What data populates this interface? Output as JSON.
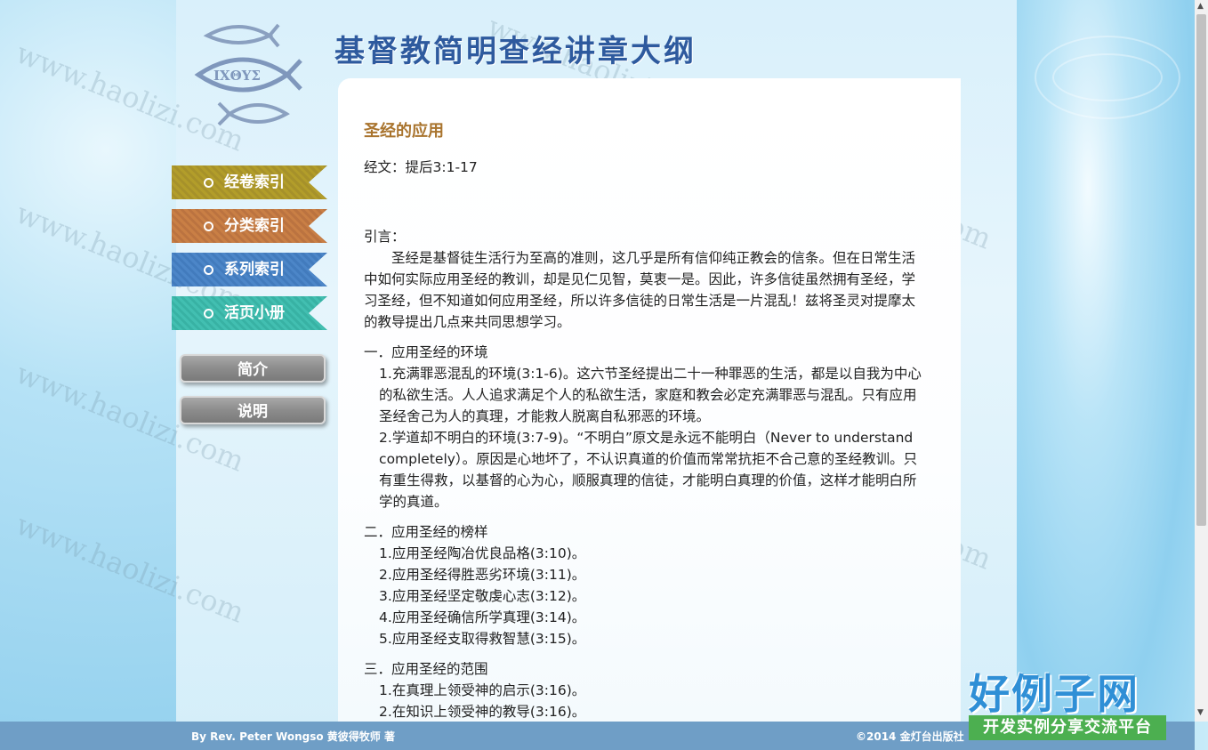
{
  "site": {
    "title": "基督教简明查经讲章大纲",
    "logo_text": "IXΘYΣ"
  },
  "nav": {
    "ribbons": [
      {
        "label": "经卷索引",
        "color": "#b29d2a"
      },
      {
        "label": "分类索引",
        "color": "#c97f45"
      },
      {
        "label": "系列索引",
        "color": "#4c86c8"
      },
      {
        "label": "活页小册",
        "color": "#42bfb1"
      }
    ],
    "buttons": [
      {
        "label": "简介"
      },
      {
        "label": "说明"
      }
    ]
  },
  "article": {
    "title": "圣经的应用",
    "scripture": "经文：提后3:1-17",
    "intro_label": "引言：",
    "intro_text": "圣经是基督徒生活行为至高的准则，这几乎是所有信仰纯正教会的信条。但在日常生活中如何实际应用圣经的教训，却是见仁见智，莫衷一是。因此，许多信徒虽然拥有圣经，学习圣经，但不知道如何应用圣经，所以许多信徒的日常生活是一片混乱！兹将圣灵对提摩太的教导提出几点来共同思想学习。",
    "sections": [
      {
        "heading": "一．应用圣经的环境",
        "items": [
          "1.充满罪恶混乱的环境(3:1-6)。这六节圣经提出二十一种罪恶的生活，都是以自我为中心的私欲生活。人人追求满足个人的私欲生活，家庭和教会必定充满罪恶与混乱。只有应用圣经舍己为人的真理，才能救人脱离自私邪恶的环境。",
          "2.学道却不明白的环境(3:7-9)。“不明白”原文是永远不能明白（Never to understand completely）。原因是心地坏了，不认识真道的价值而常常抗拒不合己意的圣经教训。只有重生得救，以基督的心为心，顺服真理的信徒，才能明白真理的价值，这样才能明白所学的真道。"
        ]
      },
      {
        "heading": "二．应用圣经的榜样",
        "items": [
          "1.应用圣经陶冶优良品格(3:10)。",
          "2.应用圣经得胜恶劣环境(3:11)。",
          "3.应用圣经坚定敬虔心志(3:12)。",
          "4.应用圣经确信所学真理(3:14)。",
          "5.应用圣经支取得救智慧(3:15)。"
        ]
      },
      {
        "heading": "三．应用圣经的范围",
        "items": [
          "1.在真理上领受神的启示(3:16)。",
          "2.在知识上领受神的教导(3:16)。"
        ]
      }
    ]
  },
  "footer": {
    "left": "By Rev. Peter Wongso 黄彼得牧师 著",
    "right": "©2014 金灯台出版社"
  },
  "watermark": "www.haolizi.com",
  "brand": {
    "main": "好例子网",
    "sub": "开发实例分享交流平台"
  }
}
